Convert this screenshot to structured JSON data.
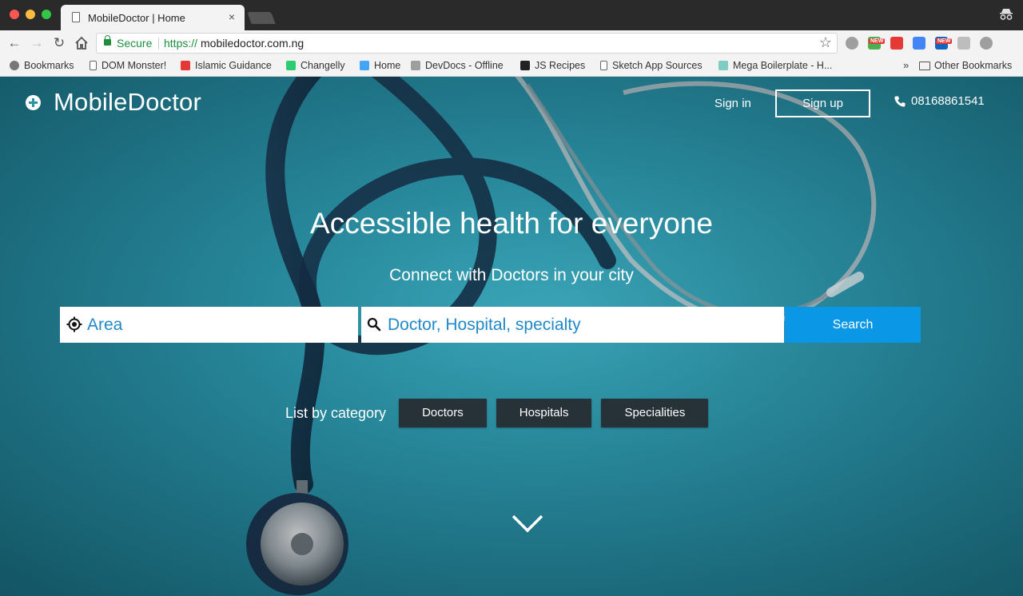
{
  "browser": {
    "tab_title": "MobileDoctor | Home",
    "tab_close": "×",
    "security_label": "Secure",
    "url_scheme": "https://",
    "url_host": "mobiledoctor.com.ng",
    "extensions": [
      {
        "name": "ext-1",
        "color": "#9e9e9e"
      },
      {
        "name": "ext-2",
        "color": "#4caf50",
        "badge": "NEW"
      },
      {
        "name": "ext-3",
        "color": "#e53935"
      },
      {
        "name": "ext-4",
        "color": "#4285f4"
      },
      {
        "name": "ext-5",
        "color": "#1565c0",
        "badge": "NEW"
      },
      {
        "name": "ext-6",
        "color": "#bdbdbd"
      },
      {
        "name": "ext-7",
        "color": "#9e9e9e"
      }
    ]
  },
  "bookmarks": {
    "items": [
      {
        "label": "Bookmarks",
        "icon": "star-icon",
        "color": "#777777"
      },
      {
        "label": "DOM Monster!",
        "icon": "doc-icon",
        "color": "#ffffff"
      },
      {
        "label": "Islamic Guidance",
        "icon": "youtube-icon",
        "color": "#e53935"
      },
      {
        "label": "Changelly",
        "icon": "changelly-icon",
        "color": "#2ecc71"
      },
      {
        "label": "Home",
        "icon": "flutter-icon",
        "color": "#42a5f5"
      },
      {
        "label": "DevDocs - Offline",
        "icon": "devdocs-icon",
        "color": "#9e9e9e"
      },
      {
        "label": "JS Recipes",
        "icon": "terminal-icon",
        "color": "#222222"
      },
      {
        "label": "Sketch App Sources",
        "icon": "doc-icon",
        "color": "#ffffff"
      },
      {
        "label": "Mega Boilerplate - H...",
        "icon": "boilerplate-icon",
        "color": "#80cbc4"
      }
    ],
    "overflow": "»",
    "other": "Other Bookmarks"
  },
  "site": {
    "brand": "MobileDoctor",
    "sign_in": "Sign in",
    "sign_up": "Sign up",
    "phone": "08168861541",
    "headline": "Accessible health for everyone",
    "subline": "Connect with Doctors in your city",
    "search": {
      "area_placeholder": "Area",
      "query_placeholder": "Doctor, Hospital, specialty",
      "button": "Search"
    },
    "category_label": "List by category",
    "categories": [
      "Doctors",
      "Hospitals",
      "Specialities"
    ]
  },
  "colors": {
    "hero_bg": "#2a93a8",
    "search_button": "#0a98e6",
    "placeholder": "#2188c9",
    "category_button": "#263238"
  }
}
